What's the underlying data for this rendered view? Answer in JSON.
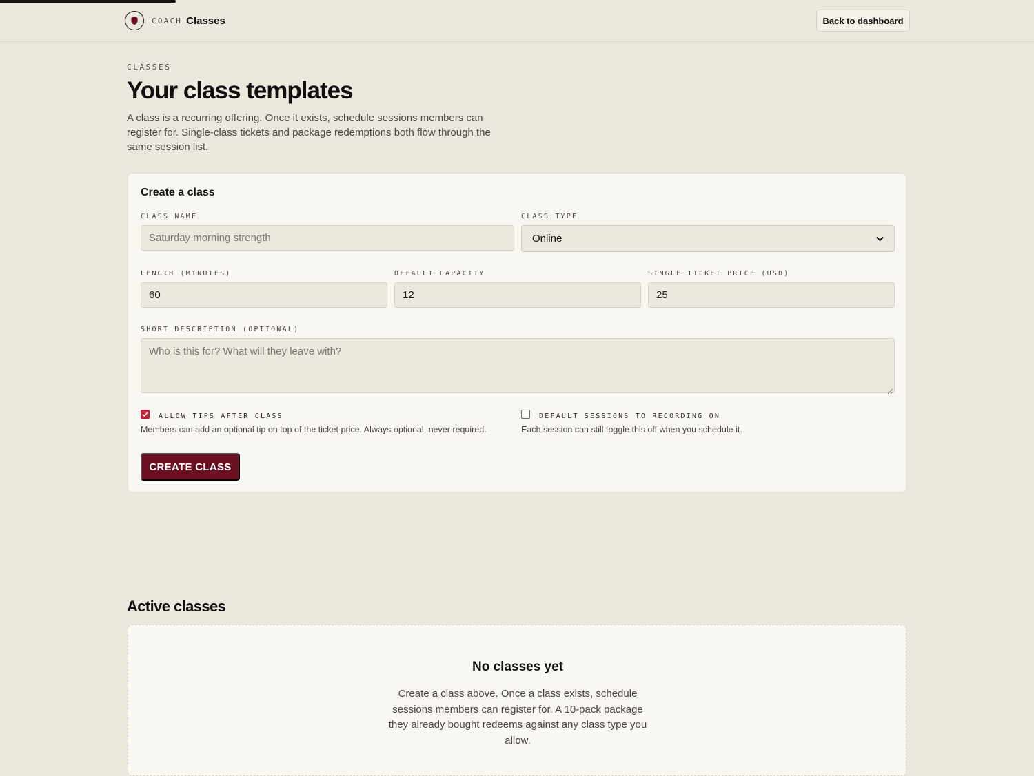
{
  "header": {
    "brand_eyebrow": "COACH",
    "brand_title": "Classes",
    "back_label": "Back to dashboard",
    "logo_icon": "shield-logo-icon"
  },
  "intro": {
    "eyebrow": "CLASSES",
    "title": "Your class templates",
    "description": "A class is a recurring offering. Once it exists, schedule sessions members can register for. Single-class tickets and package redemptions both flow through the same session list."
  },
  "form": {
    "title": "Create a class",
    "class_name": {
      "label": "CLASS NAME",
      "value": "",
      "placeholder": "Saturday morning strength"
    },
    "class_type": {
      "label": "CLASS TYPE",
      "value": "Online"
    },
    "length": {
      "label": "LENGTH (MINUTES)",
      "value": "60"
    },
    "capacity": {
      "label": "DEFAULT CAPACITY",
      "value": "12"
    },
    "price": {
      "label": "SINGLE TICKET PRICE (USD)",
      "value": "25"
    },
    "description": {
      "label": "SHORT DESCRIPTION (OPTIONAL)",
      "value": "",
      "placeholder": "Who is this for? What will they leave with?"
    },
    "allow_tips": {
      "label": "ALLOW TIPS AFTER CLASS",
      "checked": true,
      "help": "Members can add an optional tip on top of the ticket price. Always optional, never required."
    },
    "recording": {
      "label": "DEFAULT SESSIONS TO RECORDING ON",
      "checked": false,
      "help": "Each session can still toggle this off when you schedule it."
    },
    "submit_label": "CREATE CLASS"
  },
  "active": {
    "title": "Active classes",
    "empty_title": "No classes yet",
    "empty_body": "Create a class above. Once a class exists, schedule sessions members can register for. A 10-pack package they already bought redeems against any class type you allow."
  },
  "colors": {
    "background": "#ede8dd",
    "card": "#f9f7f2",
    "primary_button": "#6b1020",
    "checkbox_accent": "#c42338"
  }
}
